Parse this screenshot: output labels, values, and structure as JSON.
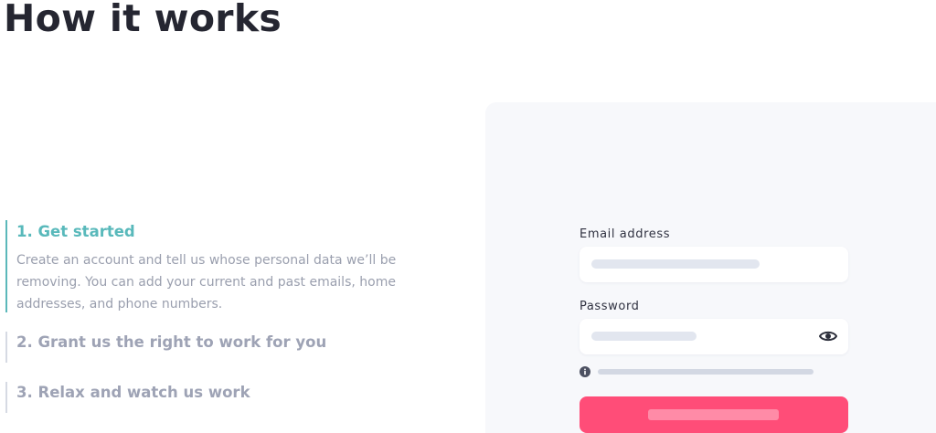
{
  "page": {
    "title": "How it works"
  },
  "steps": [
    {
      "title": "1. Get started",
      "description": "Create an account and tell us whose personal data we’ll be removing. You can add your current and past emails, home addresses, and phone numbers.",
      "active": true
    },
    {
      "title": "2. Grant us the right to work for you",
      "active": false
    },
    {
      "title": "3. Relax and watch us work",
      "active": false
    }
  ],
  "form": {
    "email_label": "Email address",
    "password_label": "Password",
    "email_value": "",
    "password_value": ""
  },
  "icons": {
    "password_toggle": "eye-icon",
    "hint": "info-icon"
  },
  "colors": {
    "accent_teal": "#59b9bb",
    "submit_button": "#ff4d78",
    "panel_background": "#f7f8fb",
    "heading": "#252631"
  }
}
